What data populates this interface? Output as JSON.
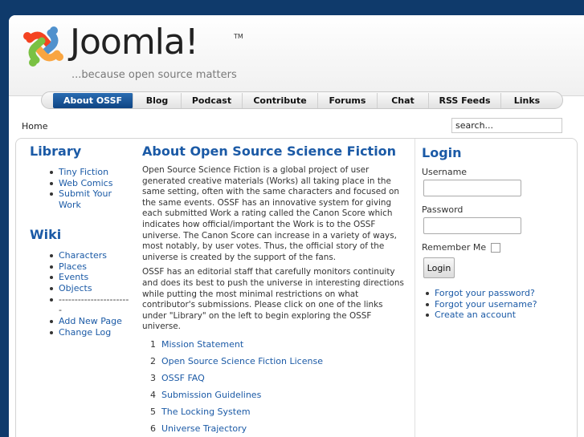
{
  "header": {
    "logo_word": "Joomla!",
    "logo_tm": "TM",
    "tagline": "...because open source matters"
  },
  "nav": [
    {
      "label": "About OSSF",
      "active": true
    },
    {
      "label": "Blog"
    },
    {
      "label": "Podcast"
    },
    {
      "label": "Contribute"
    },
    {
      "label": "Forums"
    },
    {
      "label": "Chat"
    },
    {
      "label": "RSS Feeds"
    },
    {
      "label": "Links"
    }
  ],
  "breadcrumb": "Home",
  "search": {
    "value": "search..."
  },
  "library": {
    "title": "Library",
    "items": [
      "Tiny Fiction",
      "Web Comics",
      "Submit Your Work"
    ]
  },
  "wiki": {
    "title": "Wiki",
    "items": [
      "Characters",
      "Places",
      "Events",
      "Objects",
      "-----------------------",
      "Add New Page",
      "Change Log"
    ]
  },
  "article": {
    "title": "About Open Source Science Fiction",
    "p1": "Open Source Science Fiction is a global project of user generated creative materials (Works) all taking place in the same setting, often with the same characters and focused on the same events. OSSF has an innovative system for giving each submitted Work a rating called the Canon Score which indicates how official/important the Work is to the OSSF universe.  The Canon Score can increase in a variety of ways, most notably, by user votes.  Thus, the official story of the universe is created by the support of the fans.",
    "p2": "OSSF has an editorial staff that carefully monitors continuity and does its best to push the universe in interesting directions while putting the most minimal restrictions on what contributor's submissions.  Please click on one of the links under \"Library\" on the left to begin exploring the OSSF universe.",
    "list": [
      {
        "num": "1",
        "label": "Mission Statement"
      },
      {
        "num": "2",
        "label": "Open Source Science Fiction License"
      },
      {
        "num": "3",
        "label": "OSSF FAQ"
      },
      {
        "num": "4",
        "label": "Submission Guidelines"
      },
      {
        "num": "5",
        "label": "The Locking System"
      },
      {
        "num": "6",
        "label": "Universe Trajectory"
      }
    ]
  },
  "login": {
    "title": "Login",
    "username_label": "Username",
    "password_label": "Password",
    "remember_label": "Remember Me",
    "button": "Login",
    "links": [
      "Forgot your password?",
      "Forgot your username?",
      "Create an account"
    ]
  }
}
